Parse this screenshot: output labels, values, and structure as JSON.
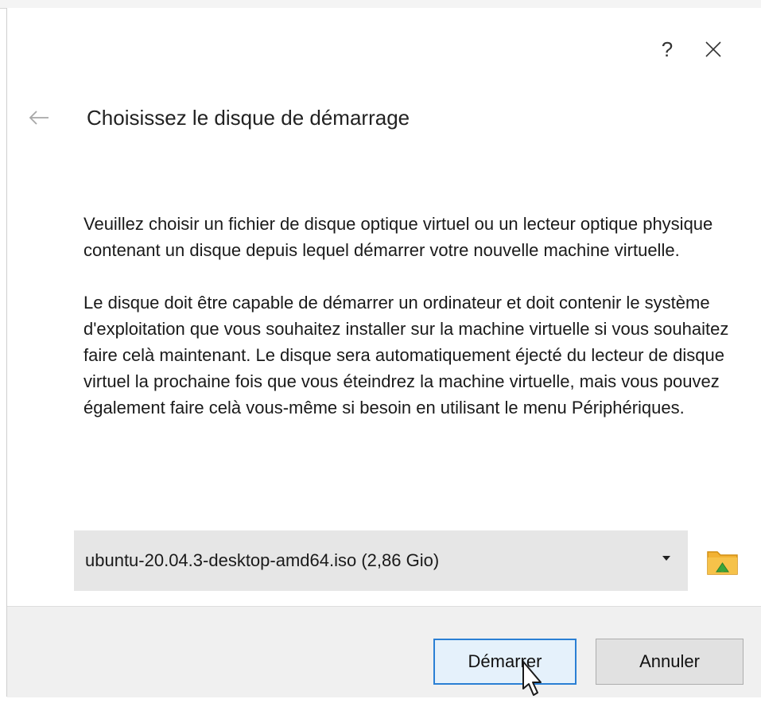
{
  "dialog": {
    "help_label": "?",
    "title": "Choisissez le disque de démarrage",
    "paragraph1": "Veuillez choisir un fichier de disque optique virtuel ou un lecteur optique physique contenant un disque depuis lequel démarrer votre nouvelle machine virtuelle.",
    "paragraph2": "Le disque doit être capable de démarrer un ordinateur et doit contenir le système d'exploitation que vous souhaitez installer sur la machine virtuelle si vous souhaitez faire celà maintenant. Le disque sera automatiquement éjecté du lecteur de disque virtuel la prochaine fois que vous éteindrez la machine virtuelle, mais vous pouvez également faire celà vous-même si besoin en utilisant le menu Périphériques.",
    "disk_selected": "ubuntu-20.04.3-desktop-amd64.iso (2,86 Gio)"
  },
  "buttons": {
    "start": "Démarrer",
    "cancel": "Annuler"
  },
  "icons": {
    "help": "help-icon",
    "close": "close-icon",
    "back": "back-arrow-icon",
    "dropdown": "chevron-down-icon",
    "folder": "folder-icon",
    "cursor": "mouse-pointer-icon"
  },
  "colors": {
    "primary_button_bg": "#e5f1fb",
    "primary_button_border": "#2a7fd4",
    "footer_bg": "#f0f0f0",
    "select_bg": "#e6e6e6"
  }
}
